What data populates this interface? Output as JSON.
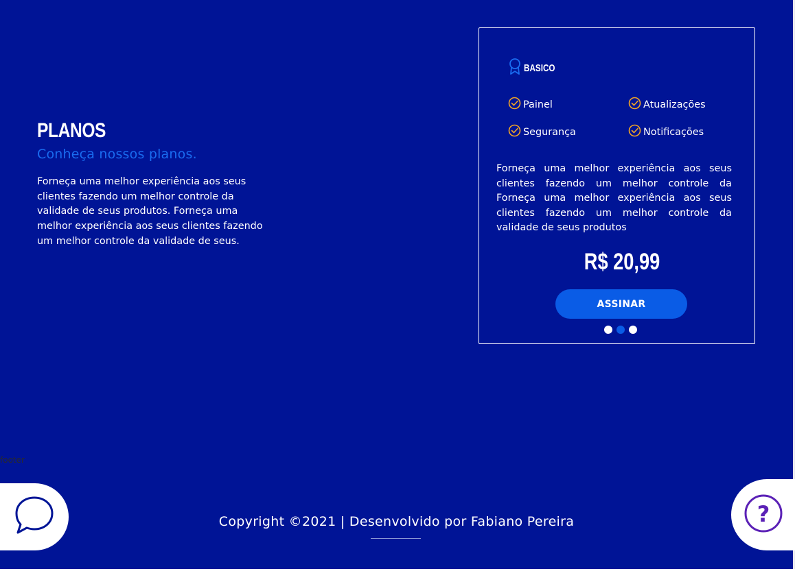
{
  "hero": {
    "title": "PLANOS",
    "subtitle": "Conheça nossos planos.",
    "description": "Forneça uma melhor experiência aos seus clientes fazendo um melhor controle da validade de seus produtos. Forneça uma melhor experiência aos seus clientes fazendo um melhor controle da validade de seus."
  },
  "plan_card": {
    "icon": "ribbon-icon",
    "name": "BASICO",
    "features": [
      "Painel",
      "Atualizações",
      "Segurança",
      "Notificações"
    ],
    "description": "Forneça uma melhor experiência aos seus clientes fazendo um melhor controle da Forneça uma melhor experiência aos seus clientes fazendo um melhor controle da validade de seus produtos",
    "price": "R$ 20,99",
    "button_label": "ASSINAR",
    "carousel": {
      "total": 3,
      "active_index": 1
    }
  },
  "footer": {
    "label": "footer",
    "copyright": "Copyright ©2021 | Desenvolvido por Fabiano Pereira"
  },
  "colors": {
    "background": "#001496",
    "accent": "#0a5ce6",
    "check": "#f5a623",
    "help": "#5b21b6"
  }
}
